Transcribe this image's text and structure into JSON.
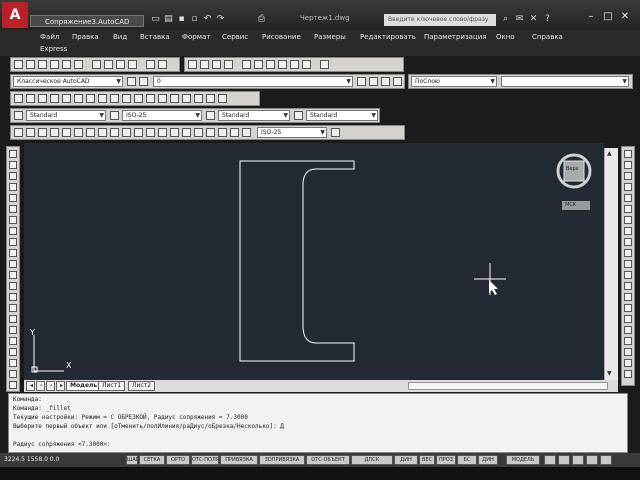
{
  "titlebar": {
    "logo": "A",
    "document_tab": "Сопряжение3.АutoCAD",
    "window_title": "Чертеж1.dwg",
    "search_placeholder": "Введите ключевое слово/фразу"
  },
  "menu": {
    "items": [
      "Файл",
      "Правка",
      "Вид",
      "Вставка",
      "Формат",
      "Сервис",
      "Рисование",
      "Размеры",
      "Редактировать",
      "Параметризация",
      "Окно",
      "Справка",
      "Express"
    ]
  },
  "toolbars": {
    "workspace": "Классическое AutoCAD",
    "layer": "0",
    "color": "ПоСлою",
    "text_style": "Standard",
    "dim_style": "ISO-25",
    "table_style": "Standard",
    "multileader_style": "Standard",
    "dim_style2": "ISO-25",
    "text_style2": "Standard"
  },
  "viewcube": {
    "face_label": "Верх",
    "wcs_label": "МСК"
  },
  "axes": {
    "x_label": "X",
    "y_label": "Y"
  },
  "layout_tabs": [
    "Модель",
    "Лист1",
    "Лист2"
  ],
  "command": {
    "lines": [
      "Команда:",
      "Команда:  _fillet",
      "Текущие настройки: Режим = С ОБРЕЗКОЙ, Радиус сопряжения = 7.3000",
      "Выберите первый объект или [оТменить/полИлиния/раДиус/оБрезка/Несколько]: Д",
      "",
      "Радиус сопряжения <7.3000>:"
    ]
  },
  "status": {
    "coords": "3224.5 1558.0 0.0",
    "buttons": [
      "ШАГ",
      "СЕТКА",
      "ОРТО",
      "ОТС-ПОЛЯР",
      "ПРИВЯЗКА",
      "3DПРИВЯЗКА",
      "ОТС-ОБЪЕКТ",
      "ДПСК",
      "ДИН",
      "ВЕС",
      "ПРОЗ",
      "БС",
      "ДИН"
    ],
    "model_label": "МОДЕЛЬ"
  },
  "colors": {
    "canvas": "#242a33",
    "drawing": "#ffffff",
    "logo": "#b8202a"
  }
}
